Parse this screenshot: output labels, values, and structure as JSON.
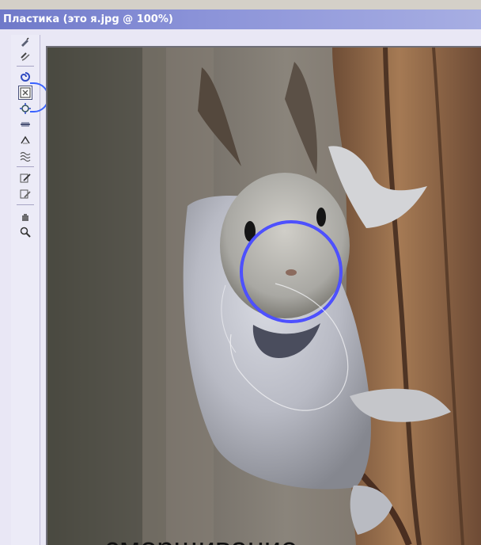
{
  "window": {
    "title": "Пластика (это я.jpg @ 100%)"
  },
  "tools": [
    {
      "name": "forward-warp-tool",
      "glyph": "✎"
    },
    {
      "name": "reconstruct-tool",
      "glyph": "↺"
    },
    {
      "name": "twirl-clockwise-tool",
      "glyph": "◎"
    },
    {
      "name": "pucker-tool",
      "glyph": "▣"
    },
    {
      "name": "bloat-tool",
      "glyph": "◇"
    },
    {
      "name": "push-left-tool",
      "glyph": "⇄"
    },
    {
      "name": "mirror-tool",
      "glyph": "⌂"
    },
    {
      "name": "turbulence-tool",
      "glyph": "≋"
    },
    {
      "name": "freeze-mask-tool",
      "glyph": "✍"
    },
    {
      "name": "thaw-mask-tool",
      "glyph": "✐"
    },
    {
      "name": "hand-tool",
      "glyph": "✋"
    },
    {
      "name": "zoom-tool",
      "glyph": "⚲"
    }
  ],
  "preview": {
    "caption": "сморщивание"
  },
  "colors": {
    "title_bar": "#7b84d3",
    "brush_circle": "#4a4dff",
    "toolbox_bg": "#ecebf7"
  }
}
